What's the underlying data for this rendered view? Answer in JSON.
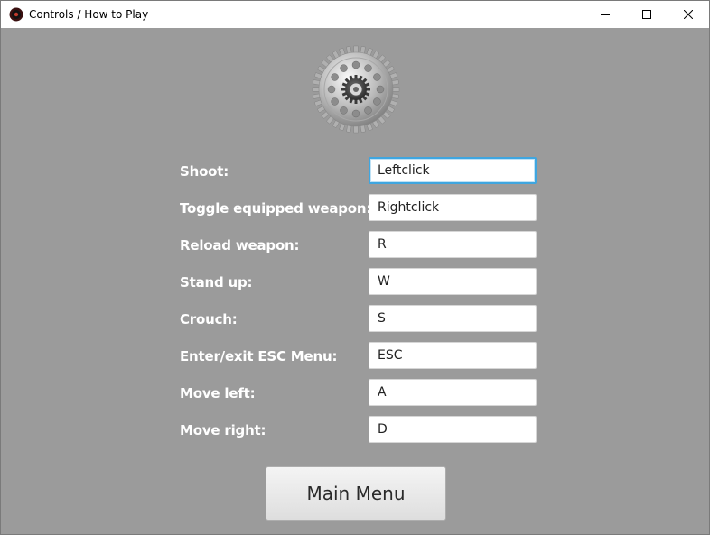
{
  "window": {
    "title": "Controls / How to Play",
    "minimize_label": "—",
    "maximize_label": "☐",
    "close_label": "✕"
  },
  "controls": [
    {
      "label": "Shoot:",
      "value": "Leftclick"
    },
    {
      "label": "Toggle equipped weapon:",
      "value": "Rightclick"
    },
    {
      "label": "Reload weapon:",
      "value": "R"
    },
    {
      "label": "Stand up:",
      "value": "W"
    },
    {
      "label": "Crouch:",
      "value": "S"
    },
    {
      "label": "Enter/exit ESC Menu:",
      "value": "ESC"
    },
    {
      "label": "Move left:",
      "value": "A"
    },
    {
      "label": "Move right:",
      "value": "D"
    }
  ],
  "main_menu_label": "Main Menu",
  "icons": {
    "app": "gear-app-icon",
    "logo": "gear-logo-icon"
  }
}
